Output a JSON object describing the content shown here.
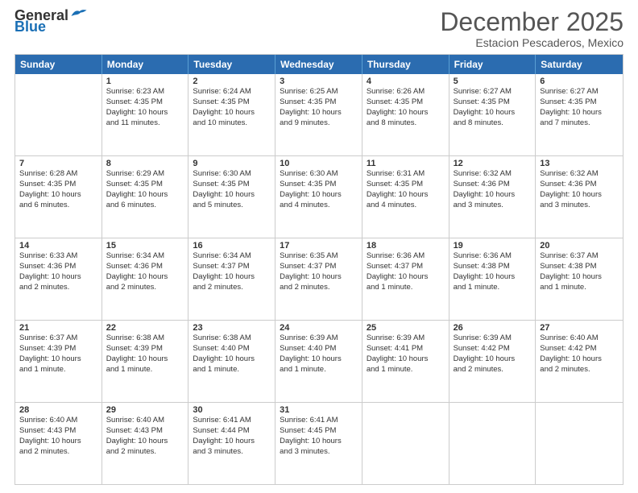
{
  "logo": {
    "text_general": "General",
    "text_blue": "Blue"
  },
  "title": "December 2025",
  "subtitle": "Estacion Pescaderos, Mexico",
  "days_of_week": [
    "Sunday",
    "Monday",
    "Tuesday",
    "Wednesday",
    "Thursday",
    "Friday",
    "Saturday"
  ],
  "weeks": [
    [
      {
        "day": "",
        "info": ""
      },
      {
        "day": "1",
        "info": "Sunrise: 6:23 AM\nSunset: 4:35 PM\nDaylight: 10 hours\nand 11 minutes."
      },
      {
        "day": "2",
        "info": "Sunrise: 6:24 AM\nSunset: 4:35 PM\nDaylight: 10 hours\nand 10 minutes."
      },
      {
        "day": "3",
        "info": "Sunrise: 6:25 AM\nSunset: 4:35 PM\nDaylight: 10 hours\nand 9 minutes."
      },
      {
        "day": "4",
        "info": "Sunrise: 6:26 AM\nSunset: 4:35 PM\nDaylight: 10 hours\nand 8 minutes."
      },
      {
        "day": "5",
        "info": "Sunrise: 6:27 AM\nSunset: 4:35 PM\nDaylight: 10 hours\nand 8 minutes."
      },
      {
        "day": "6",
        "info": "Sunrise: 6:27 AM\nSunset: 4:35 PM\nDaylight: 10 hours\nand 7 minutes."
      }
    ],
    [
      {
        "day": "7",
        "info": "Sunrise: 6:28 AM\nSunset: 4:35 PM\nDaylight: 10 hours\nand 6 minutes."
      },
      {
        "day": "8",
        "info": "Sunrise: 6:29 AM\nSunset: 4:35 PM\nDaylight: 10 hours\nand 6 minutes."
      },
      {
        "day": "9",
        "info": "Sunrise: 6:30 AM\nSunset: 4:35 PM\nDaylight: 10 hours\nand 5 minutes."
      },
      {
        "day": "10",
        "info": "Sunrise: 6:30 AM\nSunset: 4:35 PM\nDaylight: 10 hours\nand 4 minutes."
      },
      {
        "day": "11",
        "info": "Sunrise: 6:31 AM\nSunset: 4:35 PM\nDaylight: 10 hours\nand 4 minutes."
      },
      {
        "day": "12",
        "info": "Sunrise: 6:32 AM\nSunset: 4:36 PM\nDaylight: 10 hours\nand 3 minutes."
      },
      {
        "day": "13",
        "info": "Sunrise: 6:32 AM\nSunset: 4:36 PM\nDaylight: 10 hours\nand 3 minutes."
      }
    ],
    [
      {
        "day": "14",
        "info": "Sunrise: 6:33 AM\nSunset: 4:36 PM\nDaylight: 10 hours\nand 2 minutes."
      },
      {
        "day": "15",
        "info": "Sunrise: 6:34 AM\nSunset: 4:36 PM\nDaylight: 10 hours\nand 2 minutes."
      },
      {
        "day": "16",
        "info": "Sunrise: 6:34 AM\nSunset: 4:37 PM\nDaylight: 10 hours\nand 2 minutes."
      },
      {
        "day": "17",
        "info": "Sunrise: 6:35 AM\nSunset: 4:37 PM\nDaylight: 10 hours\nand 2 minutes."
      },
      {
        "day": "18",
        "info": "Sunrise: 6:36 AM\nSunset: 4:37 PM\nDaylight: 10 hours\nand 1 minute."
      },
      {
        "day": "19",
        "info": "Sunrise: 6:36 AM\nSunset: 4:38 PM\nDaylight: 10 hours\nand 1 minute."
      },
      {
        "day": "20",
        "info": "Sunrise: 6:37 AM\nSunset: 4:38 PM\nDaylight: 10 hours\nand 1 minute."
      }
    ],
    [
      {
        "day": "21",
        "info": "Sunrise: 6:37 AM\nSunset: 4:39 PM\nDaylight: 10 hours\nand 1 minute."
      },
      {
        "day": "22",
        "info": "Sunrise: 6:38 AM\nSunset: 4:39 PM\nDaylight: 10 hours\nand 1 minute."
      },
      {
        "day": "23",
        "info": "Sunrise: 6:38 AM\nSunset: 4:40 PM\nDaylight: 10 hours\nand 1 minute."
      },
      {
        "day": "24",
        "info": "Sunrise: 6:39 AM\nSunset: 4:40 PM\nDaylight: 10 hours\nand 1 minute."
      },
      {
        "day": "25",
        "info": "Sunrise: 6:39 AM\nSunset: 4:41 PM\nDaylight: 10 hours\nand 1 minute."
      },
      {
        "day": "26",
        "info": "Sunrise: 6:39 AM\nSunset: 4:42 PM\nDaylight: 10 hours\nand 2 minutes."
      },
      {
        "day": "27",
        "info": "Sunrise: 6:40 AM\nSunset: 4:42 PM\nDaylight: 10 hours\nand 2 minutes."
      }
    ],
    [
      {
        "day": "28",
        "info": "Sunrise: 6:40 AM\nSunset: 4:43 PM\nDaylight: 10 hours\nand 2 minutes."
      },
      {
        "day": "29",
        "info": "Sunrise: 6:40 AM\nSunset: 4:43 PM\nDaylight: 10 hours\nand 2 minutes."
      },
      {
        "day": "30",
        "info": "Sunrise: 6:41 AM\nSunset: 4:44 PM\nDaylight: 10 hours\nand 3 minutes."
      },
      {
        "day": "31",
        "info": "Sunrise: 6:41 AM\nSunset: 4:45 PM\nDaylight: 10 hours\nand 3 minutes."
      },
      {
        "day": "",
        "info": ""
      },
      {
        "day": "",
        "info": ""
      },
      {
        "day": "",
        "info": ""
      }
    ]
  ]
}
